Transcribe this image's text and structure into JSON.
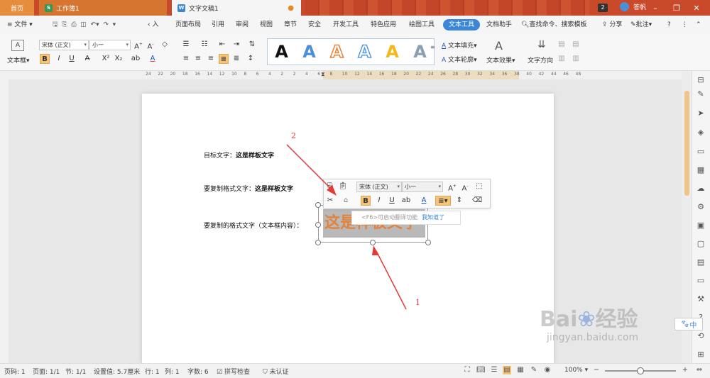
{
  "tabs": {
    "home": "首页",
    "workbook": "工作簿1",
    "document": "文字文稿1",
    "count_badge": "2",
    "user": "答帆"
  },
  "menu": {
    "file": "文件",
    "items": [
      "页面布局",
      "引用",
      "审阅",
      "视图",
      "章节",
      "安全",
      "开发工具",
      "特色应用",
      "绘图工具"
    ],
    "insert_partial": "入",
    "active": "文本工具",
    "doc_helper": "文档助手",
    "search": "查找命令、搜索模板",
    "share": "分享",
    "annotate": "批注"
  },
  "ribbon": {
    "textbox": "文本框",
    "font_name": "宋体 (正文)",
    "font_size": "小一",
    "text_fill": "文本填充",
    "text_outline": "文本轮廓",
    "text_effect": "文本效果",
    "text_direction": "文字方向",
    "gallery": [
      "A",
      "A",
      "A",
      "A",
      "A",
      "A"
    ]
  },
  "ruler_ticks": [
    "24",
    "22",
    "20",
    "18",
    "16",
    "14",
    "12",
    "10",
    "8",
    "6",
    "4",
    "2",
    "2",
    "4",
    "6",
    "8",
    "10",
    "12",
    "14",
    "16",
    "18",
    "20",
    "22",
    "24",
    "26",
    "28",
    "30",
    "32",
    "34",
    "36",
    "38",
    "40",
    "42",
    "44",
    "46",
    "48"
  ],
  "document": {
    "line1_label": "目标文字：",
    "line1_bold": "这是样板文字",
    "line2_label": "要复制格式文字：",
    "line2_bold": "这是样板文字",
    "line3_label": "要复制的格式文字（文本框内容）：",
    "textbox_content": "这是样板文字"
  },
  "floatbar": {
    "font_name": "宋体 (正文)",
    "font_size": "小一"
  },
  "tooltip": {
    "text": "<F6>可启动翻译功能",
    "link": "我知道了"
  },
  "annotations": {
    "one": "1",
    "two": "2"
  },
  "watermark": {
    "brand": "Bai",
    "brand2": "经验",
    "url": "jingyan.baidu.com"
  },
  "ime": "中",
  "status": {
    "page_code": "页码: 1",
    "page": "页面: 1/1",
    "section": "节: 1/1",
    "setting": "设置值: 5.7厘米",
    "row": "行: 1",
    "col": "列: 1",
    "chars": "字数: 6",
    "spell": "拼写检查",
    "cert": "未认证",
    "zoom": "100%"
  },
  "colors": {
    "tabbar": "#c84a2b",
    "accent": "#3b86d7",
    "arrow": "#e53935",
    "textbox_fill": "#b9b9b9",
    "textbox_text": "#e3823c"
  }
}
